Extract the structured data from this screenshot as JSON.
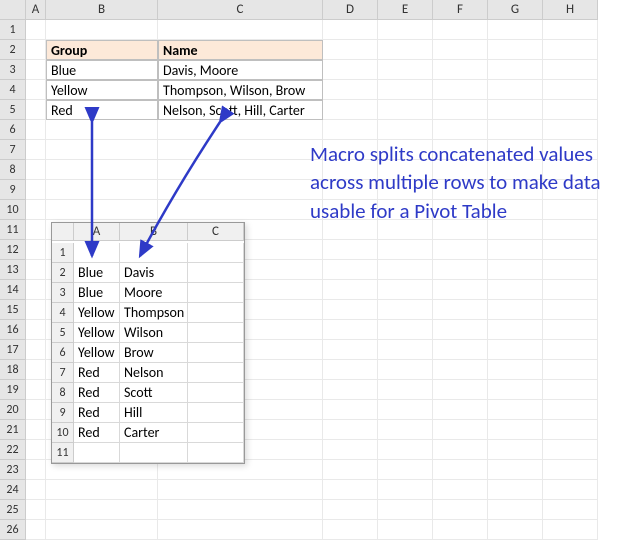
{
  "outer_sheet": {
    "columns": [
      "A",
      "B",
      "C",
      "D",
      "E",
      "F",
      "G",
      "H"
    ],
    "row_count": 26,
    "table": {
      "headers": {
        "group": "Group",
        "name": "Name"
      },
      "rows": [
        {
          "group": "Blue",
          "name": "Davis, Moore"
        },
        {
          "group": "Yellow",
          "name": "Thompson, Wilson, Brow"
        },
        {
          "group": "Red",
          "name": "Nelson, Scott, Hill, Carter"
        }
      ]
    }
  },
  "embedded_sheet": {
    "columns": [
      "A",
      "B",
      "C"
    ],
    "rows": [
      {
        "n": "1",
        "a": "",
        "b": "",
        "c": ""
      },
      {
        "n": "2",
        "a": "Blue",
        "b": "Davis",
        "c": ""
      },
      {
        "n": "3",
        "a": "Blue",
        "b": " Moore",
        "c": ""
      },
      {
        "n": "4",
        "a": "Yellow",
        "b": "Thompson",
        "c": ""
      },
      {
        "n": "5",
        "a": "Yellow",
        "b": " Wilson",
        "c": ""
      },
      {
        "n": "6",
        "a": "Yellow",
        "b": " Brow",
        "c": ""
      },
      {
        "n": "7",
        "a": "Red",
        "b": "Nelson",
        "c": ""
      },
      {
        "n": "8",
        "a": "Red",
        "b": " Scott",
        "c": ""
      },
      {
        "n": "9",
        "a": "Red",
        "b": " Hill",
        "c": ""
      },
      {
        "n": "10",
        "a": "Red",
        "b": " Carter",
        "c": ""
      },
      {
        "n": "11",
        "a": "",
        "b": "",
        "c": ""
      }
    ]
  },
  "annotation": "Macro splits concatenated values across multiple rows to make data usable for a Pivot Table"
}
